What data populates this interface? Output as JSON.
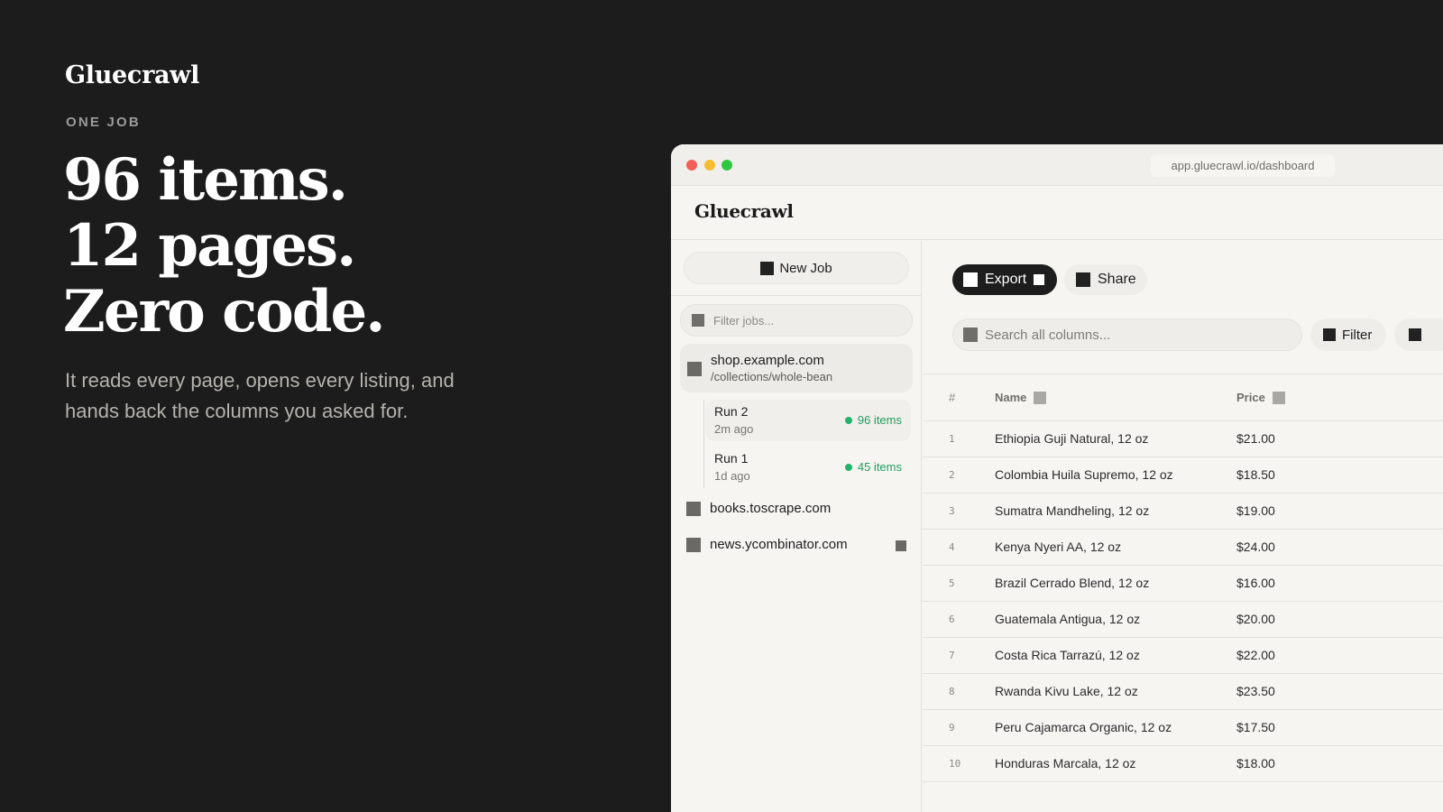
{
  "hero": {
    "brand": "Gluecrawl",
    "eyebrow": "ONE JOB",
    "headline": [
      "96 items.",
      "12 pages.",
      "Zero code."
    ],
    "subcopy": "It reads every page, opens every listing, and hands back the columns you asked for."
  },
  "window": {
    "url": "app.gluecrawl.io/dashboard",
    "app_title": "Gluecrawl"
  },
  "sidebar": {
    "new_job_label": "New Job",
    "filter_placeholder": "Filter jobs...",
    "active_job": {
      "host": "shop.example.com",
      "path": "/collections/whole-bean",
      "runs": [
        {
          "name": "Run 2",
          "time": "2m ago",
          "count": "96 items"
        },
        {
          "name": "Run 1",
          "time": "1d ago",
          "count": "45 items"
        }
      ]
    },
    "jobs": [
      "books.toscrape.com",
      "news.ycombinator.com"
    ]
  },
  "toolbar": {
    "export_label": "Export",
    "share_label": "Share",
    "search_placeholder": "Search all columns...",
    "filter_label": "Filter"
  },
  "table": {
    "headers": {
      "num": "#",
      "name": "Name",
      "price": "Price"
    },
    "rows": [
      {
        "n": "1",
        "name": "Ethiopia Guji Natural, 12 oz",
        "price": "$21.00"
      },
      {
        "n": "2",
        "name": "Colombia Huila Supremo, 12 oz",
        "price": "$18.50"
      },
      {
        "n": "3",
        "name": "Sumatra Mandheling, 12 oz",
        "price": "$19.00"
      },
      {
        "n": "4",
        "name": "Kenya Nyeri AA, 12 oz",
        "price": "$24.00"
      },
      {
        "n": "5",
        "name": "Brazil Cerrado Blend, 12 oz",
        "price": "$16.00"
      },
      {
        "n": "6",
        "name": "Guatemala Antigua, 12 oz",
        "price": "$20.00"
      },
      {
        "n": "7",
        "name": "Costa Rica Tarrazú, 12 oz",
        "price": "$22.00"
      },
      {
        "n": "8",
        "name": "Rwanda Kivu Lake, 12 oz",
        "price": "$23.50"
      },
      {
        "n": "9",
        "name": "Peru Cajamarca Organic, 12 oz",
        "price": "$17.50"
      },
      {
        "n": "10",
        "name": "Honduras Marcala, 12 oz",
        "price": "$18.00"
      }
    ]
  },
  "colors": {
    "background": "#1c1c1c",
    "window": "#f6f5f2",
    "accent_dark": "#1d1d1d",
    "success": "#22b36b"
  }
}
